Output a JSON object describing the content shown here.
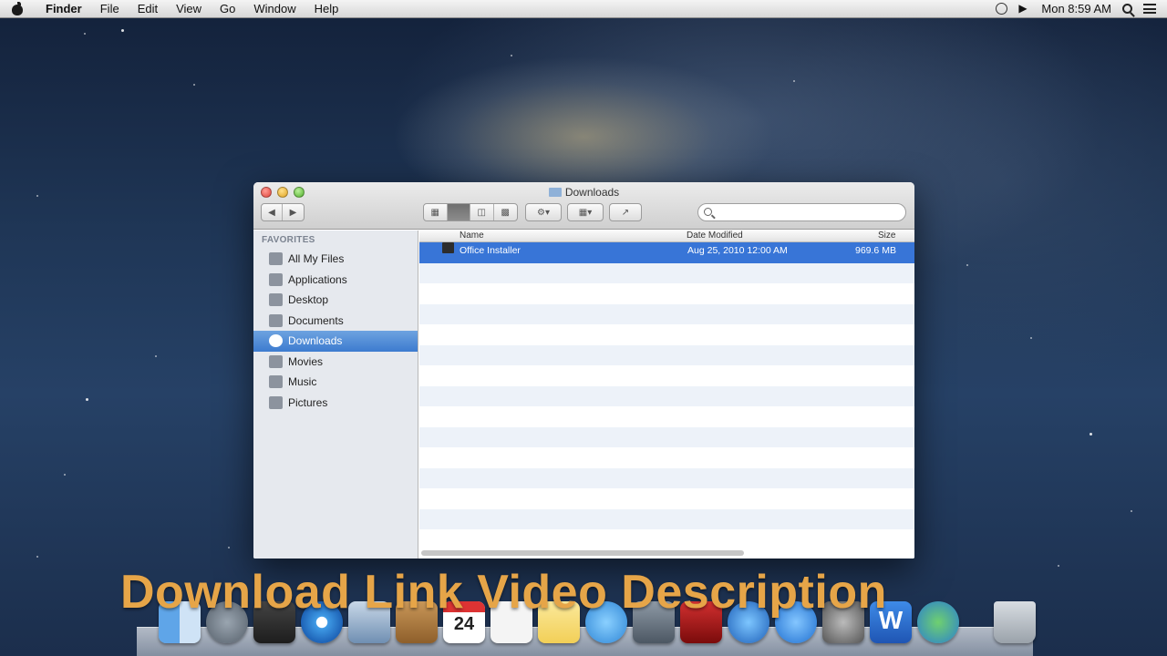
{
  "menubar": {
    "app": "Finder",
    "items": [
      "File",
      "Edit",
      "View",
      "Go",
      "Window",
      "Help"
    ],
    "clock": "Mon 8:59 AM"
  },
  "window": {
    "title": "Downloads",
    "search_placeholder": ""
  },
  "sidebar": {
    "heading": "FAVORITES",
    "items": [
      {
        "label": "All My Files",
        "icon": "all-files-icon"
      },
      {
        "label": "Applications",
        "icon": "applications-icon"
      },
      {
        "label": "Desktop",
        "icon": "desktop-icon"
      },
      {
        "label": "Documents",
        "icon": "documents-icon"
      },
      {
        "label": "Downloads",
        "icon": "downloads-icon",
        "selected": true
      },
      {
        "label": "Movies",
        "icon": "movies-icon"
      },
      {
        "label": "Music",
        "icon": "music-icon"
      },
      {
        "label": "Pictures",
        "icon": "pictures-icon"
      }
    ]
  },
  "table": {
    "columns": [
      "Name",
      "Date Modified",
      "Size"
    ],
    "rows": [
      {
        "name": "Office Installer",
        "date": "Aug 25, 2010 12:00 AM",
        "size": "969.6 MB",
        "selected": true
      }
    ]
  },
  "caption": "Download Link Video Description",
  "dock": {
    "calendar_day": "24",
    "word_letter": "W"
  },
  "colors": {
    "selection": "#3875d7",
    "sidebar_selection": "#4a88d6",
    "caption": "#e6a548"
  }
}
